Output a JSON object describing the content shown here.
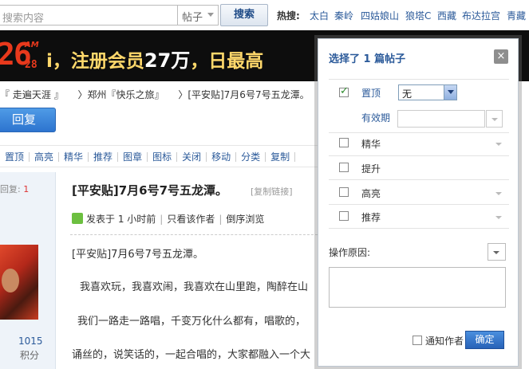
{
  "search": {
    "placeholder": "搜索内容",
    "type_label": "帖子",
    "button_label": "搜索",
    "hot_label": "热搜:",
    "hot_links": [
      "太白",
      "秦岭",
      "四姑娘山",
      "狼塔C",
      "西藏",
      "布达拉宫",
      "青藏"
    ]
  },
  "banner": {
    "clock_hours": "26",
    "clock_am": "AM",
    "clock_minutes": "28",
    "text_prefix": "i，注册会员",
    "text_number": "27万",
    "text_suffix": "，日最高"
  },
  "breadcrumb": [
    "『 走遍天涯 』",
    "〉郑州『快乐之旅』",
    "〉[平安贴]7月6号7号五龙潭。"
  ],
  "reply_button": "回复",
  "toolbar": [
    "置顶",
    "高亮",
    "精华",
    "推荐",
    "图章",
    "图标",
    "关闭",
    "移动",
    "分类",
    "复制"
  ],
  "sidebar": {
    "reply_label": "回复:",
    "reply_count": "1",
    "points_value": "1015",
    "points_label": "积分"
  },
  "post": {
    "title": "[平安贴]7月6号7号五龙潭。",
    "copy_link": "[复制链接]",
    "posted_label": "发表于",
    "posted_time": "1 小时前",
    "only_author": "只看该作者",
    "reverse_view": "倒序浏览",
    "lines": [
      "[平安贴]7月6号7号五龙潭。",
      "我喜欢玩，我喜欢闹，我喜欢在山里跑，陶醉在山",
      "我们一路走一路唱，千变万化什么都有，唱歌的，",
      "诵丝的，说笑话的，一起合唱的，大家都融入一个大"
    ]
  },
  "dialog": {
    "title": "选择了 1 篇帖子",
    "close": "×",
    "options": [
      {
        "label": "置顶",
        "checked": true
      },
      {
        "label": "精华",
        "checked": false
      },
      {
        "label": "提升",
        "checked": false
      },
      {
        "label": "高亮",
        "checked": false
      },
      {
        "label": "推荐",
        "checked": false
      }
    ],
    "top_select_value": "无",
    "valid_label": "有效期",
    "reason_label": "操作原因:",
    "notify_label": "通知作者",
    "confirm": "确定"
  }
}
